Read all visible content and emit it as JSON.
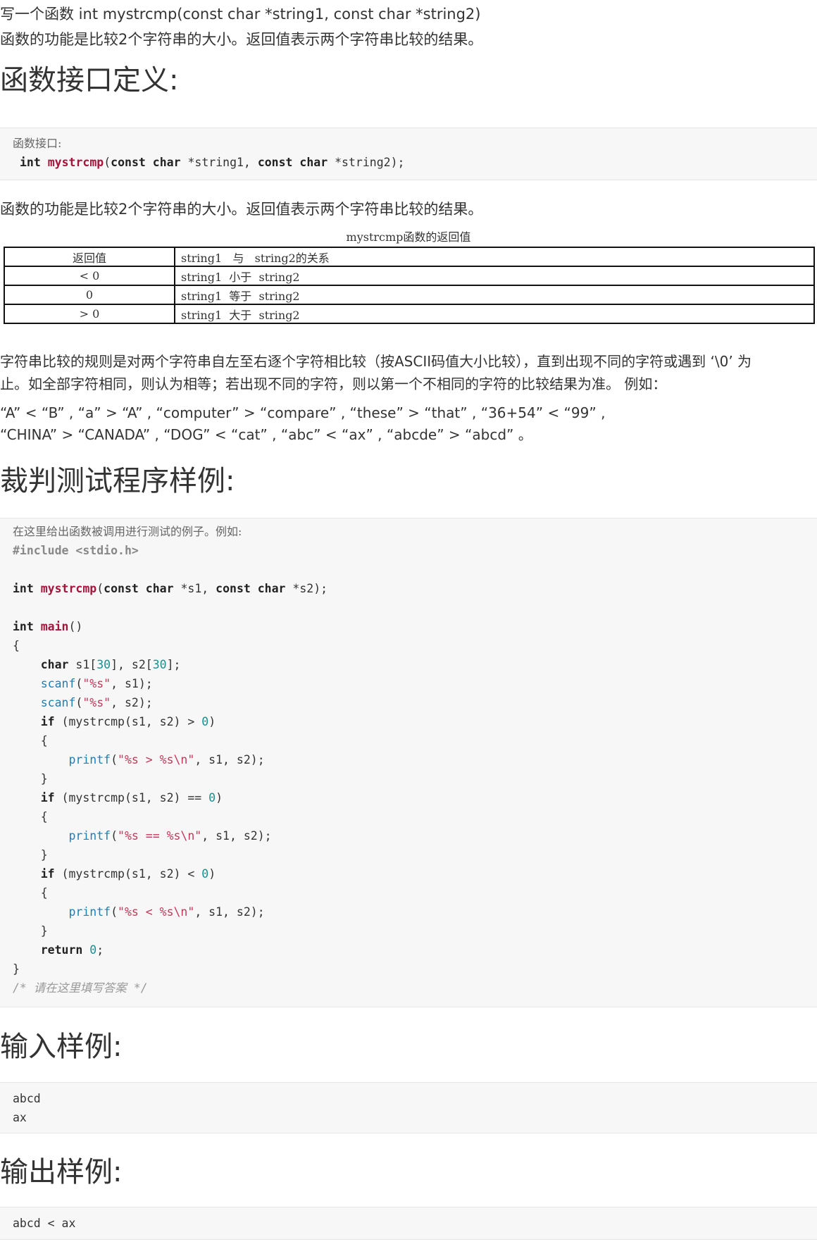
{
  "intro": {
    "line1": "写一个函数 int mystrcmp(const char *string1, const char *string2)",
    "line2": "函数的功能是比较2个字符串的大小。返回值表示两个字符串比较的结果。"
  },
  "section_interface": {
    "heading": "函数接口定义:",
    "code_note": "函数接口:",
    "code_line": {
      "t1": "int",
      "t2": "mystrcmp",
      "t3": "(",
      "t4": "const",
      "t5": "char",
      "t6": " *string1, ",
      "t7": "const",
      "t8": "char",
      "t9": " *string2);"
    }
  },
  "description": "函数的功能是比较2个字符串的大小。返回值表示两个字符串比较的结果。",
  "table": {
    "caption": "mystrcmp函数的返回值",
    "rows": [
      {
        "value": "返回值",
        "relation": "string1   与   string2的关系"
      },
      {
        "value": "< 0",
        "relation": "string1  小于  string2"
      },
      {
        "value": "0",
        "relation": "string1  等于  string2"
      },
      {
        "value": "> 0",
        "relation": "string1  大于  string2"
      }
    ]
  },
  "rules": {
    "line1": "字符串比较的规则是对两个字符串自左至右逐个字符相比较（按ASCII码值大小比较），直到出现不同的字符或遇到 ‘\\0’ 为",
    "line2": "止。如全部字符相同，则认为相等；若出现不同的字符，则以第一个不相同的字符的比较结果为准。 例如：",
    "line3": " “A” < “B” ,  “a” > “A” ,  “computer” > “compare” ,  “these” > “that” ,   “36+54” < “99” ,",
    "line4": " “CHINA” > “CANADA” ,   “DOG” < “cat” ,  “abc” < “ax” ,  “abcde” > “abcd” 。"
  },
  "section_judge": {
    "heading": "裁判测试程序样例:",
    "code_note": "在这里给出函数被调用进行测试的例子。例如:",
    "include": "#include <stdio.h>",
    "comment": "/* 请在这里填写答案 */"
  },
  "section_input": {
    "heading": "输入样例:",
    "lines": [
      "abcd",
      "ax"
    ]
  },
  "section_output": {
    "heading": "输出样例:",
    "lines": [
      "abcd < ax"
    ]
  },
  "colors": {
    "code_background": "#f7f7f7",
    "keyword": "#222222",
    "function_name": "#a3153a",
    "builtin": "#1d7fb4",
    "string": "#c0395a",
    "number": "#1b8f8f",
    "comment": "#999999"
  }
}
